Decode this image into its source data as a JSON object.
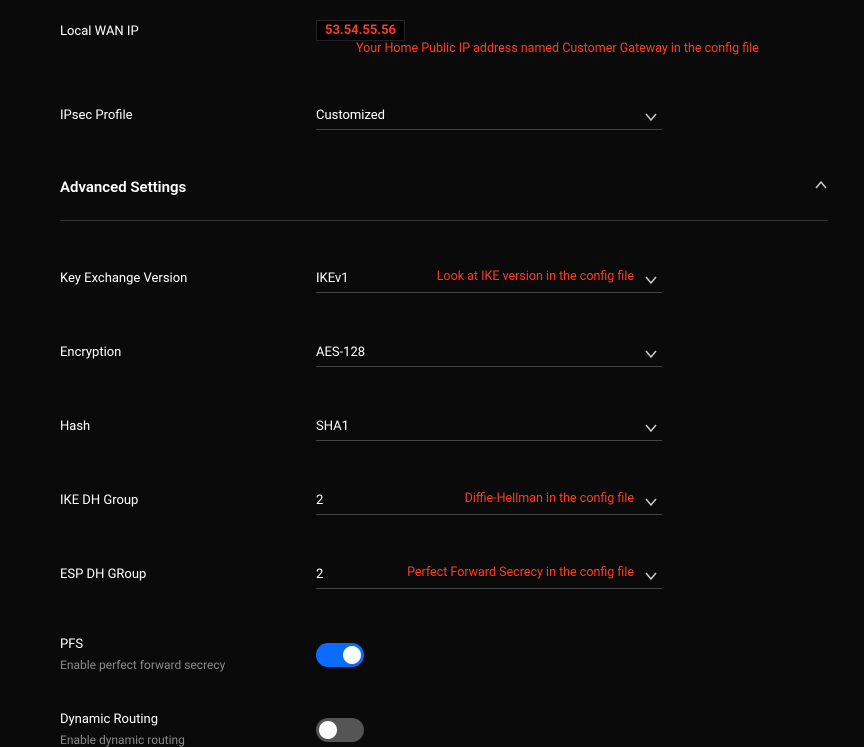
{
  "local_wan": {
    "label": "Local WAN IP",
    "value": "53.54.55.56",
    "note": "Your Home Public IP address named Customer Gateway in the config file"
  },
  "ipsec_profile": {
    "label": "IPsec Profile",
    "value": "Customized"
  },
  "advanced": {
    "title": "Advanced Settings"
  },
  "kex": {
    "label": "Key Exchange Version",
    "value": "IKEv1",
    "note": "Look at IKE version in the config file"
  },
  "encryption": {
    "label": "Encryption",
    "value": "AES-128"
  },
  "hash": {
    "label": "Hash",
    "value": "SHA1"
  },
  "ike_dh": {
    "label": "IKE DH Group",
    "value": "2",
    "note": "Diffie-Hellman in the config file"
  },
  "esp_dh": {
    "label": "ESP DH GRoup",
    "value": "2",
    "note": "Perfect Forward Secrecy in the config file"
  },
  "pfs": {
    "label": "PFS",
    "sub": "Enable perfect forward secrecy"
  },
  "dyn": {
    "label": "Dynamic Routing",
    "sub": "Enable dynamic routing"
  }
}
